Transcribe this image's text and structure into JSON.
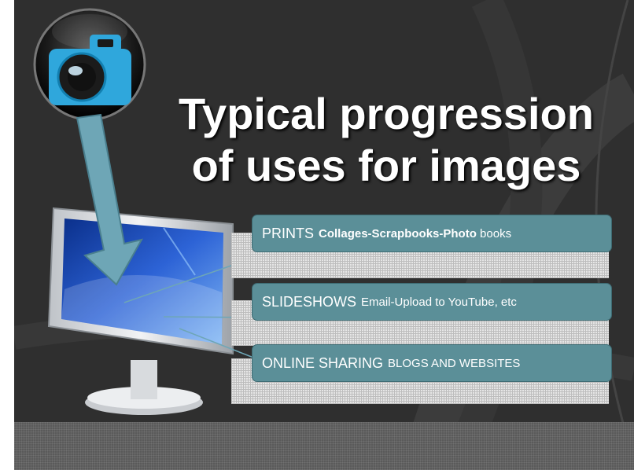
{
  "slide": {
    "title_line1": "Typical progression",
    "title_line2": "of uses for images"
  },
  "items": [
    {
      "lead": "PRINTS",
      "rest_bold": "Collages-Scrapbooks-Photo",
      "rest_plain": " books"
    },
    {
      "lead": "SLIDESHOWS",
      "rest_bold": "",
      "rest_plain": "Email-Upload to YouTube, etc"
    },
    {
      "lead": "ONLINE SHARING",
      "rest_bold": "",
      "rest_plain": "BLOGS AND WEBSITES"
    }
  ],
  "icons": [
    "camera-icon",
    "monitor-icon",
    "arrow-down-icon"
  ],
  "colors": {
    "background": "#2f2f2f",
    "box_fill": "#5b8f98",
    "camera_blue": "#2fa7dc",
    "arrow_teal": "#6ea6b6",
    "title_text": "#ffffff"
  }
}
